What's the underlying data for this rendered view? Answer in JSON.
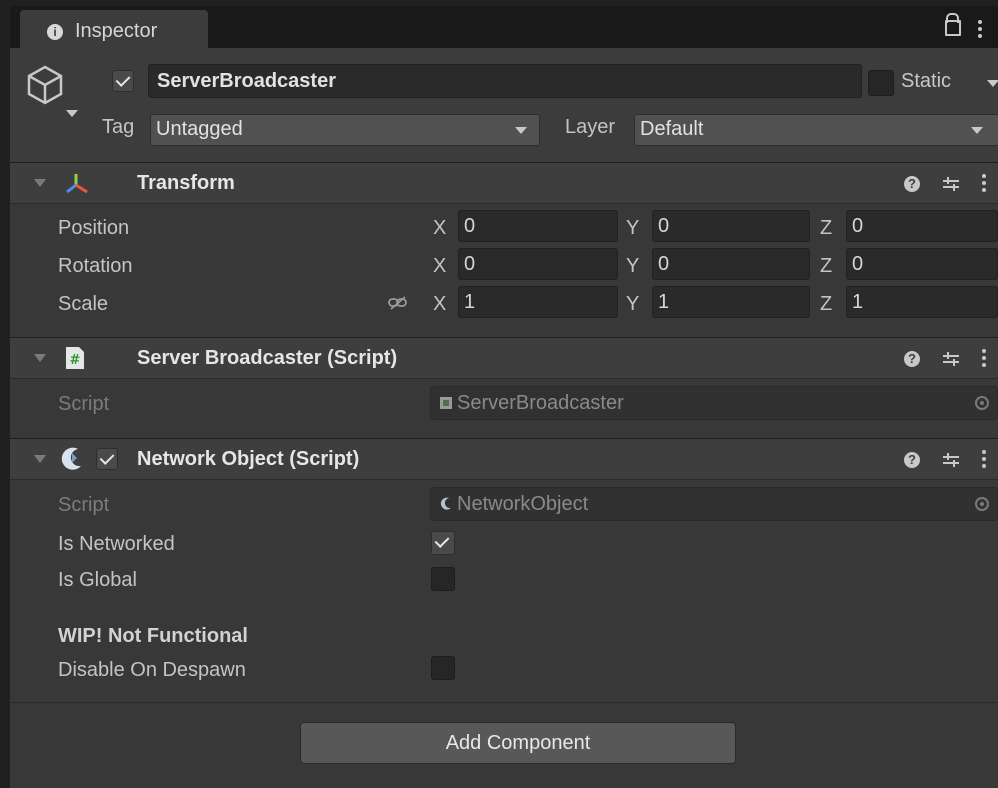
{
  "tab": {
    "label": "Inspector"
  },
  "object": {
    "name": "ServerBroadcaster",
    "static_label": "Static",
    "tag_label": "Tag",
    "tag_value": "Untagged",
    "layer_label": "Layer",
    "layer_value": "Default"
  },
  "transform": {
    "title": "Transform",
    "rows": [
      {
        "label": "Position",
        "x": "0",
        "y": "0",
        "z": "0"
      },
      {
        "label": "Rotation",
        "x": "0",
        "y": "0",
        "z": "0"
      },
      {
        "label": "Scale",
        "x": "1",
        "y": "1",
        "z": "1"
      }
    ],
    "axis_x": "X",
    "axis_y": "Y",
    "axis_z": "Z"
  },
  "server_broadcaster": {
    "title": "Server Broadcaster (Script)",
    "script_label": "Script",
    "script_value": "ServerBroadcaster"
  },
  "network_object": {
    "title": "Network Object (Script)",
    "script_label": "Script",
    "script_value": "NetworkObject",
    "is_networked_label": "Is Networked",
    "is_global_label": "Is Global",
    "wip_label": "WIP! Not Functional",
    "disable_label": "Disable On Despawn"
  },
  "add_component_label": "Add Component",
  "colors": {
    "panel": "#383838",
    "header": "#3e3e3e",
    "field": "#2a2a2a"
  }
}
